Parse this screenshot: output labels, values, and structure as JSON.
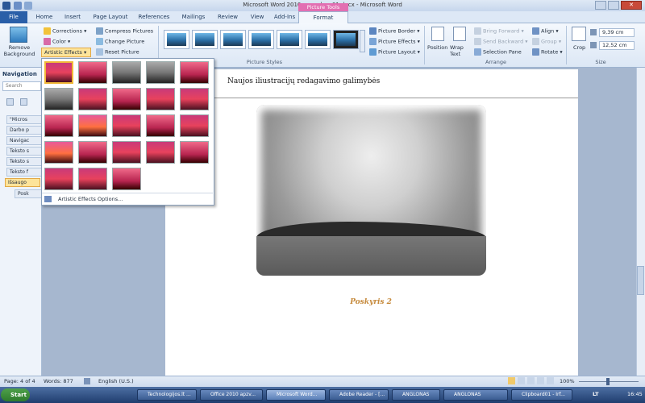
{
  "window": {
    "title": "Microsoft Word 2010_apzvalga_01.docx - Microsoft Word",
    "picture_tools": "Picture Tools"
  },
  "tabs": [
    "Home",
    "Insert",
    "Page Layout",
    "References",
    "Mailings",
    "Review",
    "View",
    "Add-Ins"
  ],
  "file_tab": "File",
  "format_tab": "Format",
  "ribbon": {
    "remove_background": "Remove Background",
    "corrections": "Corrections",
    "color": "Color",
    "artistic_effects": "Artistic Effects",
    "compress": "Compress Pictures",
    "change": "Change Picture",
    "reset": "Reset Picture",
    "styles_label": "Picture Styles",
    "border": "Picture Border",
    "effects": "Picture Effects",
    "layout": "Picture Layout",
    "position": "Position",
    "wrap": "Wrap Text",
    "bring_forward": "Bring Forward",
    "send_backward": "Send Backward",
    "selection_pane": "Selection Pane",
    "align": "Align",
    "group": "Group",
    "rotate": "Rotate",
    "arrange_label": "Arrange",
    "crop": "Crop",
    "height": "9,39 cm",
    "width": "12,52 cm",
    "size_label": "Size"
  },
  "gallery": {
    "options": "Artistic Effects Options..."
  },
  "nav": {
    "title": "Navigation",
    "search_placeholder": "Search Docum",
    "items": [
      "\"Micros",
      "Darbo p",
      "Navigac",
      "Teksto s",
      "Teksto s",
      "Teksto f",
      "Išsaugo",
      "Posk"
    ]
  },
  "document": {
    "header": "Naujos iliustracijų  redagavimo galimybės",
    "caption": "Poskyris 2"
  },
  "status": {
    "page": "Page: 4 of 4",
    "words": "Words: 877",
    "lang": "English (U.S.)",
    "zoom": "100%"
  },
  "taskbar": {
    "start": "Start",
    "items": [
      "Technologijos.lt ...",
      "Office 2010 apzv...",
      "Microsoft Word...",
      "Adobe Reader - [...",
      "ANGLONAS",
      "ANGLONAS",
      "Clipboard01 - Irf..."
    ],
    "lang": "LT",
    "time": "16:45"
  },
  "colors": {
    "accent": "#2a5fa8",
    "picture_tools": "#e26fb2",
    "selection": "#fde49a"
  }
}
